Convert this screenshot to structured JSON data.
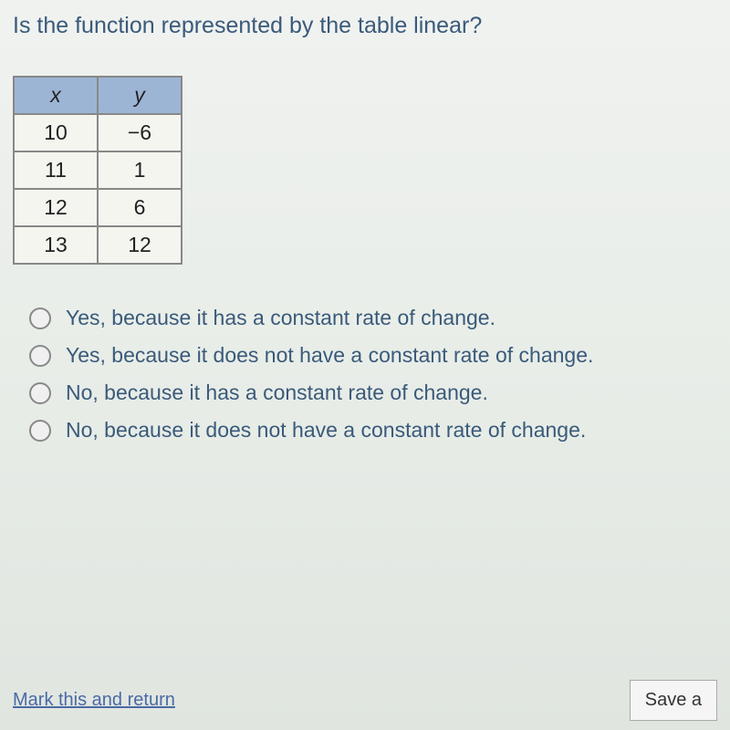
{
  "question": "Is the function represented by the table linear?",
  "table": {
    "headers": [
      "x",
      "y"
    ],
    "rows": [
      [
        "10",
        "−6"
      ],
      [
        "11",
        "1"
      ],
      [
        "12",
        "6"
      ],
      [
        "13",
        "12"
      ]
    ]
  },
  "options": [
    "Yes, because it has a constant rate of change.",
    "Yes, because it does not have a constant rate of change.",
    "No, because it has a constant rate of change.",
    "No, because it does not have a constant rate of change."
  ],
  "footer": {
    "mark_return": "Mark this and return",
    "save_label": "Save a"
  }
}
